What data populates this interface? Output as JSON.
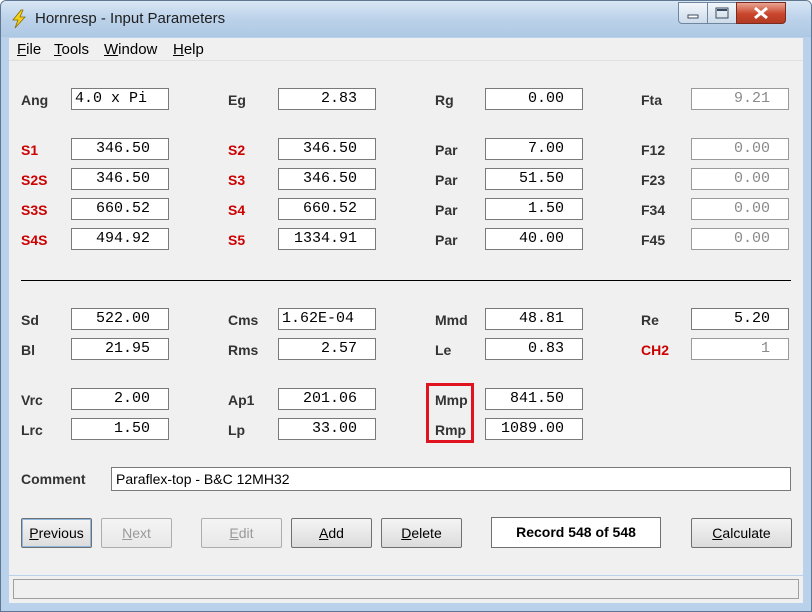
{
  "window": {
    "title": "Hornresp - Input Parameters"
  },
  "menu": [
    {
      "first": "F",
      "rest": "ile"
    },
    {
      "first": "T",
      "rest": "ools"
    },
    {
      "first": "W",
      "rest": "indow"
    },
    {
      "first": "H",
      "rest": "elp"
    }
  ],
  "horn": {
    "ang": {
      "label": "Ang",
      "value": "4.0 x Pi"
    },
    "eg": {
      "label": "Eg",
      "value": "2.83"
    },
    "rg": {
      "label": "Rg",
      "value": "0.00"
    },
    "fta": {
      "label": "Fta",
      "value": "9.21"
    },
    "s1": {
      "label": "S1",
      "value": "346.50"
    },
    "s2": {
      "label": "S2",
      "value": "346.50"
    },
    "par1": {
      "label": "Par",
      "value": "7.00"
    },
    "f12": {
      "label": "F12",
      "value": "0.00"
    },
    "s2s": {
      "label": "S2S",
      "value": "346.50"
    },
    "s3": {
      "label": "S3",
      "value": "346.50"
    },
    "par2": {
      "label": "Par",
      "value": "51.50"
    },
    "f23": {
      "label": "F23",
      "value": "0.00"
    },
    "s3s": {
      "label": "S3S",
      "value": "660.52"
    },
    "s4": {
      "label": "S4",
      "value": "660.52"
    },
    "par3": {
      "label": "Par",
      "value": "1.50"
    },
    "f34": {
      "label": "F34",
      "value": "0.00"
    },
    "s4s": {
      "label": "S4S",
      "value": "494.92"
    },
    "s5": {
      "label": "S5",
      "value": "1334.91"
    },
    "par4": {
      "label": "Par",
      "value": "40.00"
    },
    "f45": {
      "label": "F45",
      "value": "0.00"
    }
  },
  "driver": {
    "sd": {
      "label": "Sd",
      "value": "522.00"
    },
    "cms": {
      "label": "Cms",
      "value": "1.62E-04"
    },
    "mmd": {
      "label": "Mmd",
      "value": "48.81"
    },
    "re": {
      "label": "Re",
      "value": "5.20"
    },
    "bl": {
      "label": "Bl",
      "value": "21.95"
    },
    "rms": {
      "label": "Rms",
      "value": "2.57"
    },
    "le": {
      "label": "Le",
      "value": "0.83"
    },
    "ch2": {
      "label": "CH2",
      "value": "1"
    },
    "vrc": {
      "label": "Vrc",
      "value": "2.00"
    },
    "ap1": {
      "label": "Ap1",
      "value": "201.06"
    },
    "mmp": {
      "label": "Mmp",
      "value": "841.50"
    },
    "lrc": {
      "label": "Lrc",
      "value": "1.50"
    },
    "lp": {
      "label": "Lp",
      "value": "33.00"
    },
    "rmp": {
      "label": "Rmp",
      "value": "1089.00"
    }
  },
  "comment": {
    "label": "Comment",
    "value": "Paraflex-top - B&C 12MH32"
  },
  "buttons": {
    "previous": {
      "first": "P",
      "rest": "revious"
    },
    "next": {
      "first": "N",
      "rest": "ext"
    },
    "edit": {
      "first": "E",
      "rest": "dit"
    },
    "add": {
      "first": "A",
      "rest": "dd"
    },
    "delete": {
      "first": "D",
      "rest": "elete"
    },
    "calculate": {
      "first": "C",
      "rest": "alculate"
    }
  },
  "record": "Record 548 of 548",
  "colors": {
    "label_red": "#cc0000",
    "highlight": "#e0141e",
    "titlebar": "#bcd2ea"
  }
}
